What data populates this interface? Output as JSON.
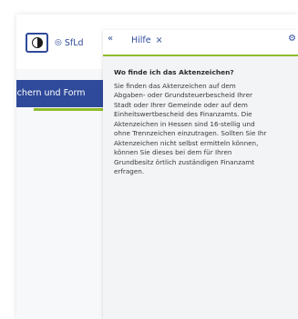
{
  "toolbar": {
    "language_label": "SfLd",
    "language_icon": "globe-icon",
    "contrast_icon": "contrast-icon"
  },
  "nav": {
    "section_label": "ichern und Form"
  },
  "help_panel": {
    "collapse_symbol": "«",
    "tab_label": "Hilfe",
    "close_symbol": "×",
    "question": "Wo finde ich das Aktenzeichen?",
    "answer_lines": [
      "Sie finden das Aktenzeichen auf dem",
      "Abgaben- oder Grundsteuerbescheid Ihrer",
      "Stadt oder Ihrer Gemeinde oder auf dem",
      "Einheitswertbescheid des Finanzamts. Die",
      "Aktenzeichen in Hessen sind 16-stellig und",
      "ohne Trennzeichen einzutragen. Sollten Sie Ihr",
      "Aktenzeichen nicht selbst ermitteln können,",
      "können Sie dieses bei dem für Ihren",
      "Grundbesitz örtlich zuständigen Finanzamt",
      "erfragen."
    ]
  },
  "colors": {
    "brand_blue": "#2f4a9a",
    "accent_green": "#8ebc2b",
    "panel_bg": "#f3f4f5"
  }
}
